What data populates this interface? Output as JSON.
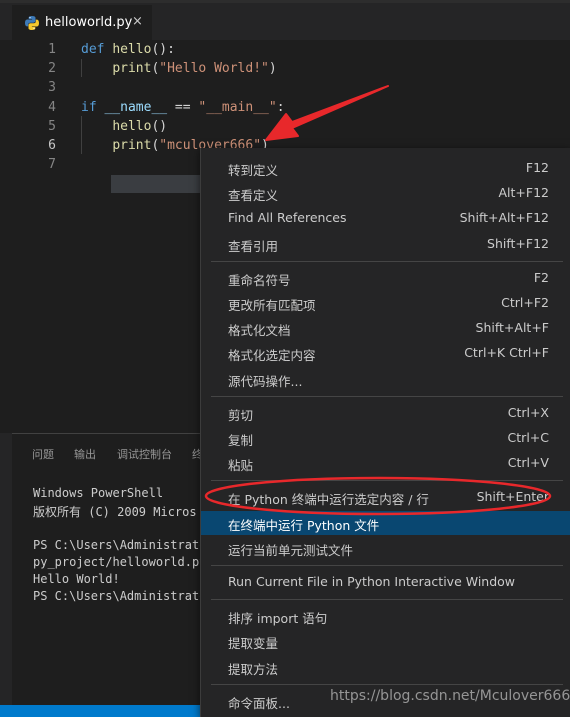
{
  "tab": {
    "title": "helloworld.py",
    "close": "×"
  },
  "editor": {
    "line_numbers": [
      "1",
      "2",
      "3",
      "4",
      "5",
      "6",
      "7"
    ],
    "lines": [
      {
        "tokens": [
          {
            "t": "def ",
            "c": "kw"
          },
          {
            "t": "hello",
            "c": "fn"
          },
          {
            "t": "():",
            "c": "punc"
          }
        ]
      },
      {
        "tokens": [
          {
            "t": "    ",
            "c": "punc"
          },
          {
            "t": "print",
            "c": "fn"
          },
          {
            "t": "(",
            "c": "punc"
          },
          {
            "t": "\"Hello World!\"",
            "c": "str"
          },
          {
            "t": ")",
            "c": "punc"
          }
        ]
      },
      {
        "tokens": []
      },
      {
        "tokens": [
          {
            "t": "if ",
            "c": "kw"
          },
          {
            "t": "__name__",
            "c": "var"
          },
          {
            "t": " == ",
            "c": "punc"
          },
          {
            "t": "\"__main__\"",
            "c": "str"
          },
          {
            "t": ":",
            "c": "punc"
          }
        ]
      },
      {
        "tokens": [
          {
            "t": "    ",
            "c": "punc"
          },
          {
            "t": "hello",
            "c": "fn"
          },
          {
            "t": "()",
            "c": "punc"
          }
        ]
      },
      {
        "tokens": [
          {
            "t": "    ",
            "c": "punc"
          },
          {
            "t": "print",
            "c": "fn"
          },
          {
            "t": "(",
            "c": "punc"
          },
          {
            "t": "\"mculover666\"",
            "c": "str"
          },
          {
            "t": ")",
            "c": "punc"
          }
        ]
      },
      {
        "tokens": []
      }
    ]
  },
  "panel": {
    "tabs": [
      "问题",
      "输出",
      "调试控制台",
      "终"
    ],
    "terminal_lines": [
      "Windows PowerShell",
      "版权所有 (C) 2009 Micros",
      "",
      "PS C:\\Users\\Administrato",
      "py_project/helloworld.py",
      "Hello World!",
      "PS C:\\Users\\Administrato"
    ]
  },
  "menu": {
    "groups": [
      [
        {
          "label": "转到定义",
          "key": "F12"
        },
        {
          "label": "查看定义",
          "key": "Alt+F12"
        },
        {
          "label": "Find All References",
          "key": "Shift+Alt+F12"
        },
        {
          "label": "查看引用",
          "key": "Shift+F12"
        }
      ],
      [
        {
          "label": "重命名符号",
          "key": "F2"
        },
        {
          "label": "更改所有匹配项",
          "key": "Ctrl+F2"
        },
        {
          "label": "格式化文档",
          "key": "Shift+Alt+F"
        },
        {
          "label": "格式化选定内容",
          "key": "Ctrl+K Ctrl+F"
        },
        {
          "label": "源代码操作...",
          "key": ""
        }
      ],
      [
        {
          "label": "剪切",
          "key": "Ctrl+X"
        },
        {
          "label": "复制",
          "key": "Ctrl+C"
        },
        {
          "label": "粘贴",
          "key": "Ctrl+V"
        }
      ],
      [
        {
          "label": "在 Python 终端中运行选定内容 / 行",
          "key": "Shift+Enter"
        },
        {
          "label": "在终端中运行 Python 文件",
          "key": "",
          "highlighted": true
        },
        {
          "label": "运行当前单元测试文件",
          "key": ""
        }
      ],
      [
        {
          "label": "Run Current File in Python Interactive Window",
          "key": ""
        }
      ],
      [
        {
          "label": "排序 import 语句",
          "key": ""
        },
        {
          "label": "提取变量",
          "key": ""
        },
        {
          "label": "提取方法",
          "key": ""
        }
      ],
      [
        {
          "label": "命令面板...",
          "key": ""
        }
      ]
    ]
  },
  "watermark": "https://blog.csdn.net/Mculover666",
  "colors": {
    "accent": "#007acc",
    "highlight": "#094771",
    "annotation": "#e8282b"
  }
}
